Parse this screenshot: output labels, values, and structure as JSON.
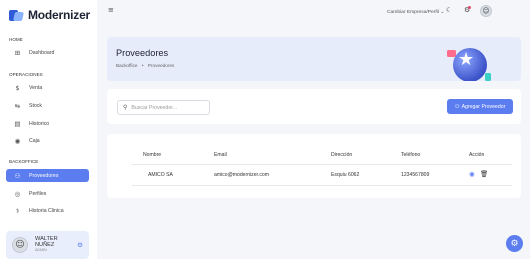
{
  "app": {
    "name": "Modernizer"
  },
  "sidebar": {
    "sections": [
      {
        "title": "HOME",
        "items": [
          {
            "label": "Dashboard",
            "icon": "dashboard-icon"
          }
        ]
      },
      {
        "title": "OPERACIONES",
        "items": [
          {
            "label": "Venta",
            "icon": "dollar-icon"
          },
          {
            "label": "Stock",
            "icon": "swap-icon"
          },
          {
            "label": "Historico",
            "icon": "list-icon"
          },
          {
            "label": "Caja",
            "icon": "cash-icon"
          }
        ]
      },
      {
        "title": "BACKOFFICE",
        "items": [
          {
            "label": "Proveedores",
            "icon": "users-icon",
            "active": true
          },
          {
            "label": "Perfiles",
            "icon": "profile-icon"
          },
          {
            "label": "Historia Clinica",
            "icon": "clinic-icon"
          }
        ]
      }
    ],
    "user": {
      "name_line1": "WALTER",
      "name_line2": "NUÑEZ",
      "role": "ADMIN"
    }
  },
  "topbar": {
    "company_label": "Cambiar Empresa/Perfil",
    "company_chevron": "⌄"
  },
  "banner": {
    "title": "Proveedores",
    "breadcrumb": [
      "Backoffice",
      "Proveedores"
    ],
    "breadcrumb_separator": "•"
  },
  "search": {
    "placeholder": "Buscar Proveedor..."
  },
  "add_button": {
    "label": "Agregar Proveedor"
  },
  "table": {
    "columns": [
      "Nombre",
      "Email",
      "Dirección",
      "Teléfono",
      "Acción"
    ],
    "rows": [
      {
        "nombre": "AMICO SA",
        "email": "amico@modernizer.com",
        "direccion": "Esquiu 6062",
        "telefono": "1234567809"
      }
    ]
  },
  "colors": {
    "accent": "#5b7df0",
    "banner_bg": "#e6ecfa",
    "page_bg": "#f4f6f9"
  }
}
